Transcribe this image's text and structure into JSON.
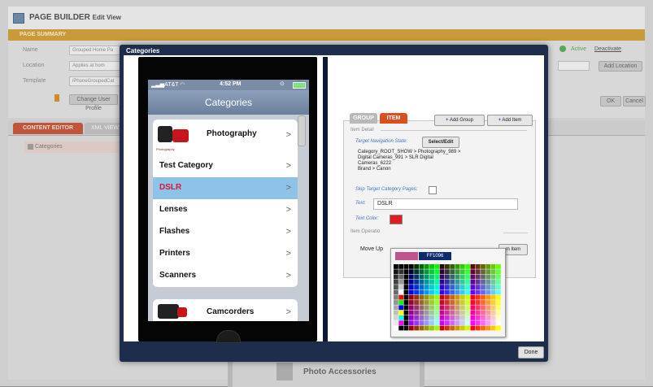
{
  "background": {
    "app_name": "PAGE BUILDER",
    "view_name": "Edit View",
    "summary_label": "PAGE SUMMARY",
    "fields": [
      {
        "label": "Name",
        "value": "Grouped Home Pa"
      },
      {
        "label": "Location",
        "value": "Applies at hom"
      },
      {
        "label": "Template",
        "value": "iPhoneGroupedCat"
      }
    ],
    "active_label": "Active",
    "deactivate_label": "Deactivate",
    "add_location_label": "Add Location",
    "change_profile_label": "Change User Profile",
    "ok_label": "OK",
    "cancel_label": "Cancel",
    "tabs": [
      "CONTENT EDITOR",
      "XML VIEW"
    ],
    "tree_item": "Categories",
    "photo_accessories": "Photo Accessories"
  },
  "modal": {
    "title": "Categories",
    "done_label": "Done",
    "phone": {
      "carrier": "AT&T",
      "time": "4:52 PM",
      "nav_title": "Categories",
      "photo_caption": "Photography",
      "items": [
        {
          "label": "Photography",
          "selected": false
        },
        {
          "label": "Test Category",
          "selected": false
        },
        {
          "label": "DSLR",
          "selected": true
        },
        {
          "label": "Lenses",
          "selected": false
        },
        {
          "label": "Flashes",
          "selected": false
        },
        {
          "label": "Printers",
          "selected": false
        },
        {
          "label": "Scanners",
          "selected": false
        },
        {
          "label": "Camcorders",
          "selected": false
        }
      ],
      "chevron": ">"
    },
    "editor": {
      "tab_group": "GROUP",
      "tab_item": "ITEM",
      "add_group_label": "Add Group",
      "add_item_label": "Add Item",
      "item_detail_title": "Item Detail",
      "target_nav_label": "Target Navigation State:",
      "select_edit_label": "Select/Edit",
      "path_lines": [
        "Category_ROOT_SHOW > Photography_989 >",
        "Digital Cameras_991 > SLR Digital",
        "Cameras_6222",
        "Brand > Canon"
      ],
      "skip_label": "Skip Target Category Pages:",
      "text_label": "Text:",
      "text_value": "DSLR",
      "text_color_label": "Text Color:",
      "text_color": "#e21b23",
      "item_operations_title": "Item Operatio",
      "move_up_label": "Move Up",
      "partial_button_label": "m Item"
    },
    "picker": {
      "current_color": "#c1538f",
      "hex_value": "FF1096"
    }
  },
  "colors": {
    "modal_bg": "#1f2d4d",
    "selected_row": "#8ec3e7",
    "selected_text": "#d9173a",
    "item_tab": "#d94f1d",
    "summary_bar": "#c99a3b"
  }
}
